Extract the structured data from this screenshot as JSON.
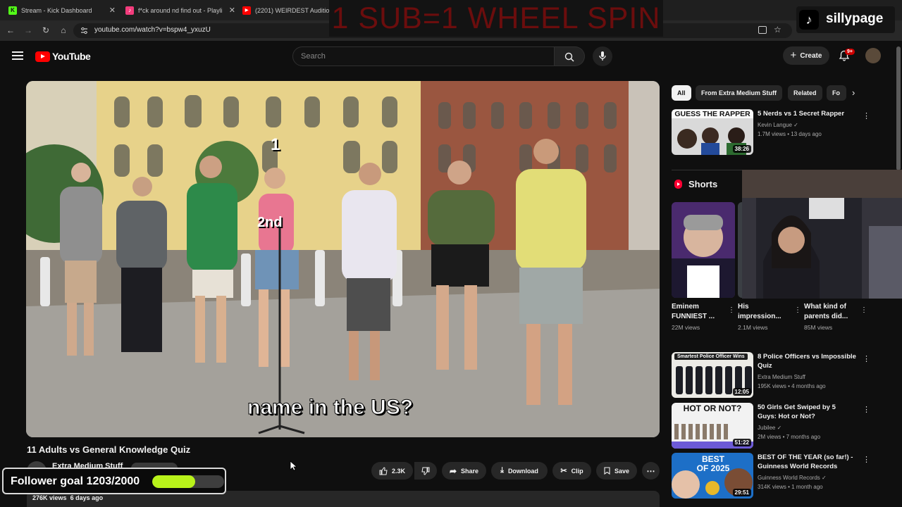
{
  "browser": {
    "tabs": [
      {
        "title": "Stream - Kick Dashboard",
        "color": "#53fc18",
        "glyph": "K"
      },
      {
        "title": "f*ck around nd find out - Playli",
        "color": "#f33c7c",
        "glyph": "♪"
      },
      {
        "title": "(2201) WEIRDEST Auditions T",
        "color": "#ff0000",
        "glyph": "▶"
      }
    ],
    "url": "youtube.com/watch?v=bspw4_yxuzU"
  },
  "overlay": {
    "banner": "1 SUB=1 WHEEL SPIN",
    "tiktok_name": "sillypage",
    "follower_goal": "Follower goal 1203/2000",
    "follower_progress": 0.6015
  },
  "header": {
    "logo_text": "YouTube",
    "search_placeholder": "Search",
    "create_label": "Create",
    "notification_count": "9+"
  },
  "video": {
    "caption_part1": "name in",
    "caption_part2": "the US?",
    "rank1": "1",
    "rank2": "2nd",
    "title": "11 Adults vs General Knowledge Quiz",
    "channel": "Extra Medium Stuff",
    "likes": "2.3K",
    "share": "Share",
    "download": "Download",
    "clip": "Clip",
    "save": "Save",
    "views": "276K views",
    "age": "6 days ago"
  },
  "sidebar": {
    "chips": [
      "All",
      "From Extra Medium Stuff",
      "Related",
      "Fo"
    ],
    "shorts_label": "Shorts",
    "recommendations": [
      {
        "title": "5 Nerds vs 1 Secret Rapper",
        "channel": "Kevin Langue",
        "meta": "1.7M views • 13 days ago",
        "duration": "38:26",
        "thumb_text": "GUESS THE RAPPER",
        "verified": true
      },
      {
        "title": "8 Police Officers vs Impossible Quiz",
        "channel": "Extra Medium Stuff",
        "meta": "195K views • 4 months ago",
        "duration": "12:05",
        "thumb_text": "Smartest Police Officer Wins",
        "verified": false
      },
      {
        "title": "50 Girls Get Swiped by 5 Guys: Hot or Not?",
        "channel": "Jubilee",
        "meta": "2M views • 7 months ago",
        "duration": "51:22",
        "thumb_text": "HOT OR NOT?",
        "verified": true
      },
      {
        "title": "BEST OF THE YEAR (so far!) - Guinness World Records",
        "channel": "Guinness World Records",
        "meta": "314K views • 1 month ago",
        "duration": "29:51",
        "thumb_text": "BEST OF 2025",
        "verified": true
      }
    ],
    "shorts": [
      {
        "title": "Eminem FUNNIEST ...",
        "views": "22M views"
      },
      {
        "title": "His impression...",
        "views": "2.1M views"
      },
      {
        "title": "What kind of parents did...",
        "views": "85M views"
      }
    ]
  }
}
